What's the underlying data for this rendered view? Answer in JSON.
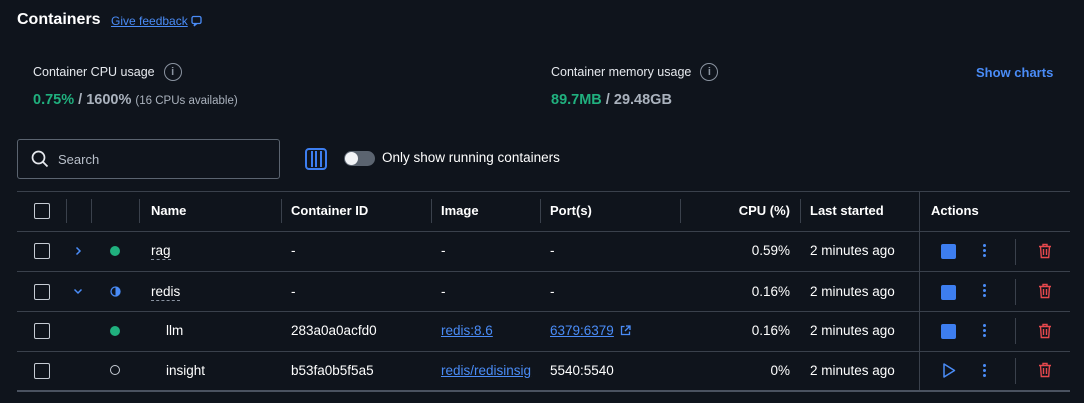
{
  "header": {
    "title": "Containers",
    "feedback_label": "Give feedback"
  },
  "stats": {
    "cpu": {
      "label": "Container CPU usage",
      "used": "0.75%",
      "sep": " / ",
      "total": "1600%",
      "note": "(16 CPUs available)"
    },
    "memory": {
      "label": "Container memory usage",
      "used": "89.7MB",
      "sep": " / ",
      "total": "29.48GB"
    },
    "show_charts_label": "Show charts"
  },
  "search": {
    "placeholder": "Search",
    "value": ""
  },
  "filter": {
    "label": "Only show running containers",
    "enabled": false
  },
  "table": {
    "headers": {
      "name": "Name",
      "container_id": "Container ID",
      "image": "Image",
      "ports": "Port(s)",
      "cpu": "CPU (%)",
      "last_started": "Last started",
      "actions": "Actions"
    },
    "rows": [
      {
        "name": "rag",
        "container_id": "-",
        "image": "-",
        "ports": "-",
        "cpu": "0.59%",
        "last_started": "2 minutes ago",
        "status": "running",
        "expand": "collapsed"
      },
      {
        "name": "redis",
        "container_id": "-",
        "image": "-",
        "ports": "-",
        "cpu": "0.16%",
        "last_started": "2 minutes ago",
        "status": "partial",
        "expand": "expanded"
      },
      {
        "name": "llm",
        "container_id": "283a0a0acfd0",
        "image": "redis:8.6",
        "ports": "6379:6379",
        "cpu": "0.16%",
        "last_started": "2 minutes ago",
        "status": "running"
      },
      {
        "name": "insight",
        "container_id": "b53fa0b5f5a5",
        "image": "redis/redisinsig",
        "ports": "5540:5540",
        "cpu": "0%",
        "last_started": "2 minutes ago",
        "status": "stopped"
      }
    ]
  },
  "colors": {
    "accent": "#3d7ef0",
    "running": "#20b07e",
    "danger": "#e5484d",
    "background": "#0f141c"
  }
}
